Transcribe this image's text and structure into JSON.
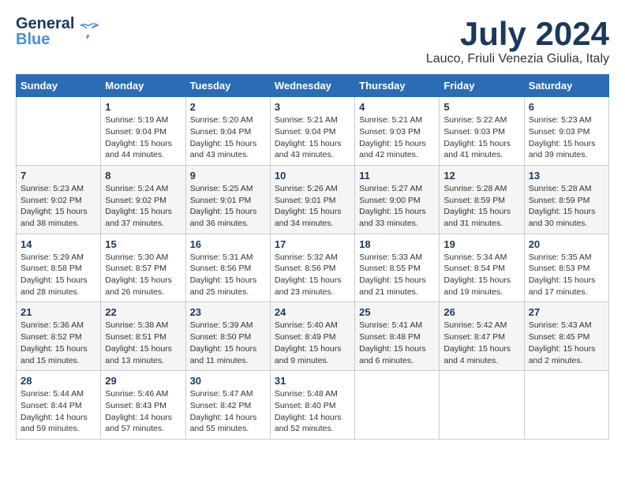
{
  "header": {
    "logo_general": "General",
    "logo_blue": "Blue",
    "month_title": "July 2024",
    "location": "Lauco, Friuli Venezia Giulia, Italy"
  },
  "calendar": {
    "days_of_week": [
      "Sunday",
      "Monday",
      "Tuesday",
      "Wednesday",
      "Thursday",
      "Friday",
      "Saturday"
    ],
    "weeks": [
      [
        {
          "num": "",
          "info": ""
        },
        {
          "num": "1",
          "info": "Sunrise: 5:19 AM\nSunset: 9:04 PM\nDaylight: 15 hours\nand 44 minutes."
        },
        {
          "num": "2",
          "info": "Sunrise: 5:20 AM\nSunset: 9:04 PM\nDaylight: 15 hours\nand 43 minutes."
        },
        {
          "num": "3",
          "info": "Sunrise: 5:21 AM\nSunset: 9:04 PM\nDaylight: 15 hours\nand 43 minutes."
        },
        {
          "num": "4",
          "info": "Sunrise: 5:21 AM\nSunset: 9:03 PM\nDaylight: 15 hours\nand 42 minutes."
        },
        {
          "num": "5",
          "info": "Sunrise: 5:22 AM\nSunset: 9:03 PM\nDaylight: 15 hours\nand 41 minutes."
        },
        {
          "num": "6",
          "info": "Sunrise: 5:23 AM\nSunset: 9:03 PM\nDaylight: 15 hours\nand 39 minutes."
        }
      ],
      [
        {
          "num": "7",
          "info": "Sunrise: 5:23 AM\nSunset: 9:02 PM\nDaylight: 15 hours\nand 38 minutes."
        },
        {
          "num": "8",
          "info": "Sunrise: 5:24 AM\nSunset: 9:02 PM\nDaylight: 15 hours\nand 37 minutes."
        },
        {
          "num": "9",
          "info": "Sunrise: 5:25 AM\nSunset: 9:01 PM\nDaylight: 15 hours\nand 36 minutes."
        },
        {
          "num": "10",
          "info": "Sunrise: 5:26 AM\nSunset: 9:01 PM\nDaylight: 15 hours\nand 34 minutes."
        },
        {
          "num": "11",
          "info": "Sunrise: 5:27 AM\nSunset: 9:00 PM\nDaylight: 15 hours\nand 33 minutes."
        },
        {
          "num": "12",
          "info": "Sunrise: 5:28 AM\nSunset: 8:59 PM\nDaylight: 15 hours\nand 31 minutes."
        },
        {
          "num": "13",
          "info": "Sunrise: 5:28 AM\nSunset: 8:59 PM\nDaylight: 15 hours\nand 30 minutes."
        }
      ],
      [
        {
          "num": "14",
          "info": "Sunrise: 5:29 AM\nSunset: 8:58 PM\nDaylight: 15 hours\nand 28 minutes."
        },
        {
          "num": "15",
          "info": "Sunrise: 5:30 AM\nSunset: 8:57 PM\nDaylight: 15 hours\nand 26 minutes."
        },
        {
          "num": "16",
          "info": "Sunrise: 5:31 AM\nSunset: 8:56 PM\nDaylight: 15 hours\nand 25 minutes."
        },
        {
          "num": "17",
          "info": "Sunrise: 5:32 AM\nSunset: 8:56 PM\nDaylight: 15 hours\nand 23 minutes."
        },
        {
          "num": "18",
          "info": "Sunrise: 5:33 AM\nSunset: 8:55 PM\nDaylight: 15 hours\nand 21 minutes."
        },
        {
          "num": "19",
          "info": "Sunrise: 5:34 AM\nSunset: 8:54 PM\nDaylight: 15 hours\nand 19 minutes."
        },
        {
          "num": "20",
          "info": "Sunrise: 5:35 AM\nSunset: 8:53 PM\nDaylight: 15 hours\nand 17 minutes."
        }
      ],
      [
        {
          "num": "21",
          "info": "Sunrise: 5:36 AM\nSunset: 8:52 PM\nDaylight: 15 hours\nand 15 minutes."
        },
        {
          "num": "22",
          "info": "Sunrise: 5:38 AM\nSunset: 8:51 PM\nDaylight: 15 hours\nand 13 minutes."
        },
        {
          "num": "23",
          "info": "Sunrise: 5:39 AM\nSunset: 8:50 PM\nDaylight: 15 hours\nand 11 minutes."
        },
        {
          "num": "24",
          "info": "Sunrise: 5:40 AM\nSunset: 8:49 PM\nDaylight: 15 hours\nand 9 minutes."
        },
        {
          "num": "25",
          "info": "Sunrise: 5:41 AM\nSunset: 8:48 PM\nDaylight: 15 hours\nand 6 minutes."
        },
        {
          "num": "26",
          "info": "Sunrise: 5:42 AM\nSunset: 8:47 PM\nDaylight: 15 hours\nand 4 minutes."
        },
        {
          "num": "27",
          "info": "Sunrise: 5:43 AM\nSunset: 8:45 PM\nDaylight: 15 hours\nand 2 minutes."
        }
      ],
      [
        {
          "num": "28",
          "info": "Sunrise: 5:44 AM\nSunset: 8:44 PM\nDaylight: 14 hours\nand 59 minutes."
        },
        {
          "num": "29",
          "info": "Sunrise: 5:46 AM\nSunset: 8:43 PM\nDaylight: 14 hours\nand 57 minutes."
        },
        {
          "num": "30",
          "info": "Sunrise: 5:47 AM\nSunset: 8:42 PM\nDaylight: 14 hours\nand 55 minutes."
        },
        {
          "num": "31",
          "info": "Sunrise: 5:48 AM\nSunset: 8:40 PM\nDaylight: 14 hours\nand 52 minutes."
        },
        {
          "num": "",
          "info": ""
        },
        {
          "num": "",
          "info": ""
        },
        {
          "num": "",
          "info": ""
        }
      ]
    ]
  }
}
